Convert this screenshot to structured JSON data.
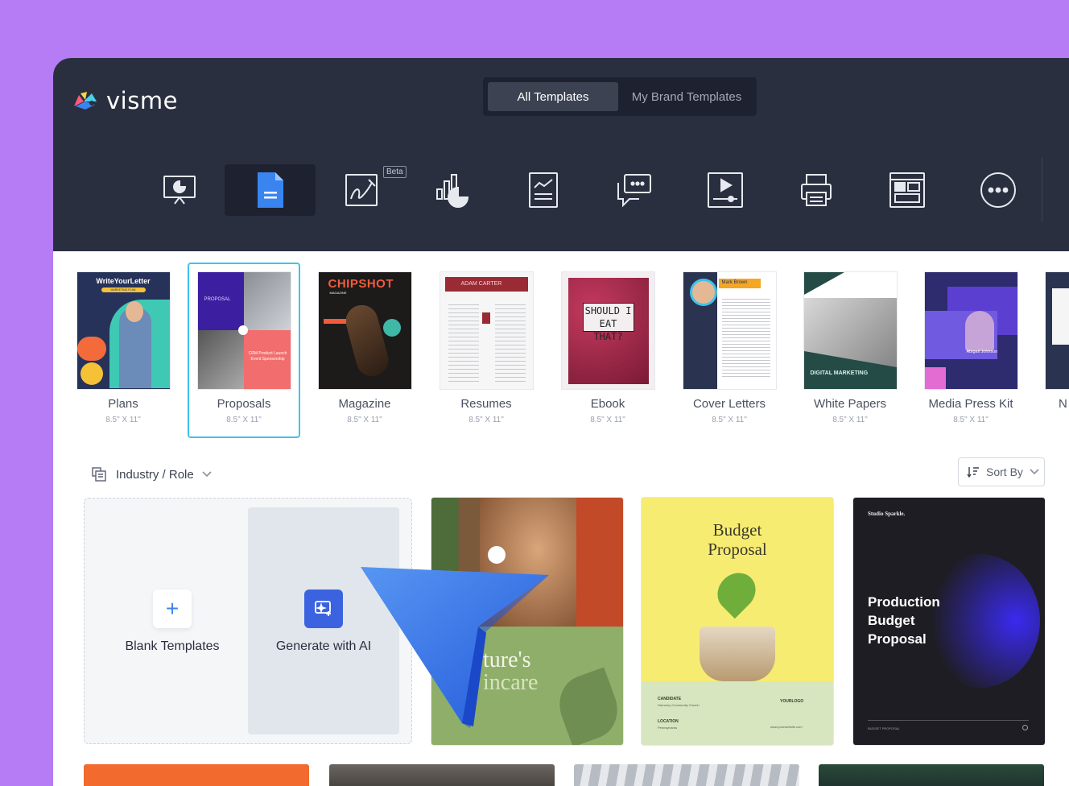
{
  "brand": {
    "name": "visme"
  },
  "tabs": [
    {
      "label": "All Templates",
      "active": true
    },
    {
      "label": "My Brand Templates",
      "active": false
    }
  ],
  "categories": [
    {
      "icon": "presentation-icon"
    },
    {
      "icon": "document-icon",
      "active": true
    },
    {
      "icon": "whiteboard-icon",
      "badge": "Beta"
    },
    {
      "icon": "infographic-icon"
    },
    {
      "icon": "report-icon"
    },
    {
      "icon": "social-chat-icon"
    },
    {
      "icon": "video-icon"
    },
    {
      "icon": "printable-icon"
    },
    {
      "icon": "web-graphic-icon"
    },
    {
      "icon": "more-icon"
    }
  ],
  "templates": [
    {
      "name": "Plans",
      "size": "8.5\" X 11\"",
      "thumb_title": "WriteYourLetter",
      "thumb_sub": "MARKETING PLAN"
    },
    {
      "name": "Proposals",
      "size": "8.5\" X 11\"",
      "thumb_title": "PROPOSAL",
      "thumb_sub": "CRM Product Launch Event Sponsorship"
    },
    {
      "name": "Magazine",
      "size": "8.5\" X 11\"",
      "thumb_title": "CHIPSHOT",
      "thumb_sub": "MAGAZINE"
    },
    {
      "name": "Resumes",
      "size": "8.5\" X 11\"",
      "thumb_title": "ADAM CARTER"
    },
    {
      "name": "Ebook",
      "size": "8.5\" X 11\"",
      "thumb_title": "SHOULD I EAT THAT?"
    },
    {
      "name": "Cover Letters",
      "size": "8.5\" X 11\"",
      "thumb_title": "Mark Brown"
    },
    {
      "name": "White Papers",
      "size": "8.5\" X 11\"",
      "thumb_title": "DIGITAL MARKETING"
    },
    {
      "name": "Media Press Kit",
      "size": "8.5\" X 11\"",
      "thumb_title": "Abigail Johnson"
    },
    {
      "name": "N"
    }
  ],
  "filter": {
    "label": "Industry / Role"
  },
  "sort": {
    "label": "Sort By"
  },
  "blank": {
    "label": "Blank Templates"
  },
  "ai": {
    "label": "Generate with AI"
  },
  "cards": [
    {
      "title_a": "ture's",
      "title_b": "incare"
    },
    {
      "title_a": "Budget",
      "title_b": "Proposal",
      "candidate_label": "CANDIDATE",
      "candidate_value": "Harmony Community Church",
      "location_label": "LOCATION",
      "location_value": "Pennsylvania",
      "logo": "YOURLOGO",
      "site": "www.yourwebsite.com"
    },
    {
      "studio": "Studio Sparkle.",
      "title_a": "Production",
      "title_b": "Budget",
      "title_c": "Proposal",
      "footer": "BUDGET PROPOSAL"
    }
  ],
  "colors": {
    "background": "#b57cf6",
    "topbar": "#2a2f3f",
    "accent": "#3ec3ea",
    "ai": "#3b63e0"
  }
}
